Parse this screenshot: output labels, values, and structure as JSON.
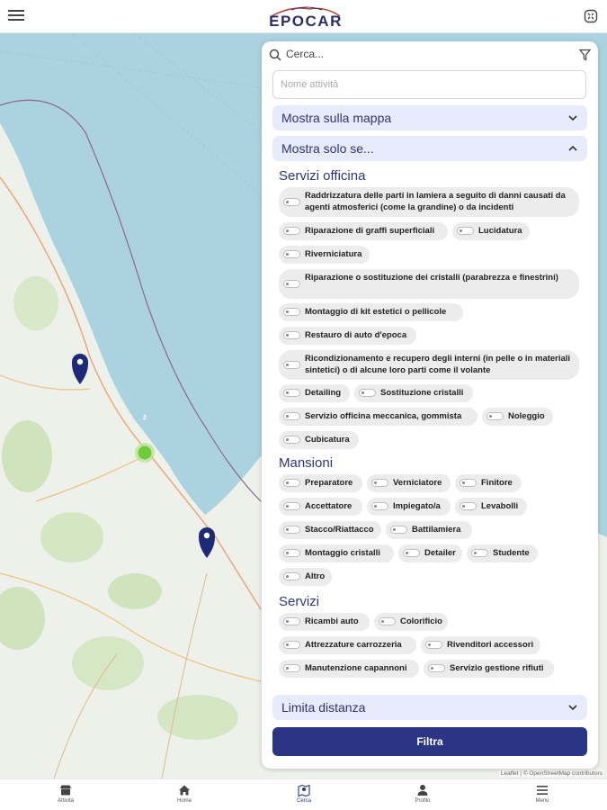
{
  "header": {
    "logo_text": "EPOCAR",
    "menu_icon": "hamburger-icon",
    "fullscreen_icon": "fullscreen-icon"
  },
  "map": {
    "attribution": "Leaflet | © OpenStreetMap contributors",
    "cluster_count": "2",
    "sea_color": "#aad3df",
    "land_color": "#eef0ea",
    "marker_color": "#1e2a78",
    "cluster_color": "#8dd45f"
  },
  "panel": {
    "search_placeholder": "Cerca...",
    "name_placeholder": "Nome attività",
    "show_on_map": "Mostra sulla mappa",
    "show_only_if": "Mostra solo se...",
    "limit_distance": "Limita distanza",
    "filter_button": "Filtra",
    "sections": [
      {
        "title": "Servizi officina",
        "chips": [
          "Raddrizzatura delle parti in lamiera a seguito di danni causati da agenti atmosferici (come la grandine) o da incidenti",
          "Riparazione di graffi superficiali",
          "Lucidatura",
          "Riverniciatura",
          "Riparazione o sostituzione dei cristalli (parabrezza e finestrini)",
          "Montaggio di kit estetici o pellicole",
          "Restauro di auto d'epoca",
          "Ricondizionamento e recupero degli interni (in pelle o in materiali sintetici) o di alcune loro parti come il volante",
          "Detailing",
          "Sostituzione cristalli",
          "Servizio officina meccanica, gommista",
          "Noleggio",
          "Cubicatura"
        ]
      },
      {
        "title": "Mansioni",
        "chips": [
          "Preparatore",
          "Verniciatore",
          "Finitore",
          "Accettatore",
          "Impiegato/a",
          "Levabolli",
          "Stacco/Riattacco",
          "Battilamiera",
          "Montaggio cristalli",
          "Detailer",
          "Studente",
          "Altro"
        ]
      },
      {
        "title": "Servizi",
        "chips": [
          "Ricambi auto",
          "Colorificio",
          "Attrezzature carrozzeria",
          "Rivenditori accessori",
          "Manutenzione capannoni",
          "Servizio gestione rifiuti"
        ]
      }
    ],
    "accent_color": "#2b3585"
  },
  "bottom_nav": [
    {
      "label": "Attività",
      "icon": "shop-icon"
    },
    {
      "label": "Home",
      "icon": "home-icon"
    },
    {
      "label": "Cerca",
      "icon": "map-pin-icon",
      "active": true
    },
    {
      "label": "Profilo",
      "icon": "user-icon"
    },
    {
      "label": "Menù",
      "icon": "menu-icon"
    }
  ]
}
